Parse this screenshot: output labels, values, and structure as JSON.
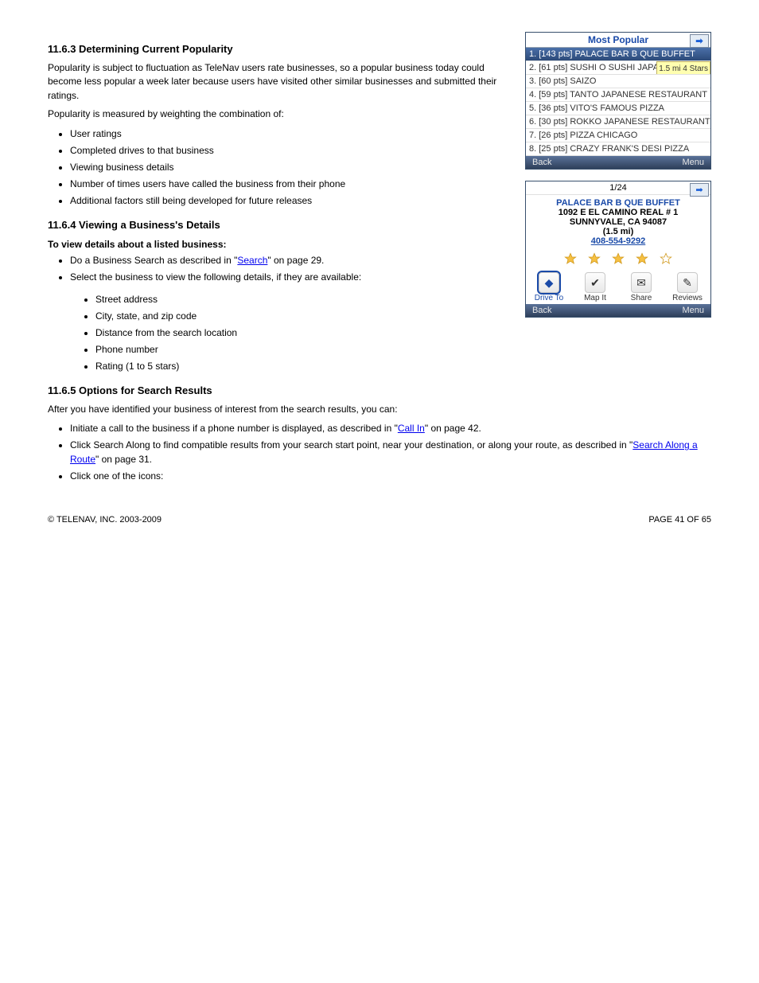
{
  "section1": {
    "title": "11.6.3 Determining Current Popularity",
    "p1": "Popularity is subject to fluctuation as TeleNav users rate businesses, so a popular business today could become less popular a week later because users have visited other similar businesses and submitted their ratings.",
    "p2": "Popularity is measured by weighting the combination of:",
    "bullets": [
      "User ratings",
      "Completed drives to that business",
      "Viewing business details",
      "Number of times users have called the business from their phone",
      "Additional factors still being developed for future releases"
    ]
  },
  "section2": {
    "title": "11.6.4 Viewing a Business's Details",
    "lead_head": "To view details about a listed business:",
    "lead_bullets": [
      {
        "pre": "Do a Business Search as described in \"",
        "link": "Search",
        "post": "\" on page 29."
      },
      {
        "text": "Select the business to view the following details, if they are available:"
      }
    ],
    "detail_bullets": [
      "Street address",
      "City, state, and zip code",
      "Distance from the search location",
      "Phone number",
      "Rating (1 to 5 stars)"
    ]
  },
  "section3": {
    "title": "11.6.5 Options for Search Results",
    "lead": "After you have identified your business of interest from the search results, you can:",
    "bullets": [
      {
        "pre": "Initiate a call to the business if a phone number is displayed, as described in \"",
        "link": "Call In",
        "post": "\" on page 42."
      },
      {
        "pre": "Click Search Along to find compatible results from your search start point, near your destination, or along your route, as described in \"",
        "link": "Search Along a Route",
        "post": "\" on page 31."
      },
      {
        "text": "Click one of the icons:"
      }
    ]
  },
  "popular_mock": {
    "title": "Most Popular",
    "items": [
      {
        "label": "1. [143 pts] PALACE BAR B QUE BUFFET",
        "selected": true
      },
      {
        "label": "2. [61 pts] SUSHI O SUSHI JAPAN",
        "tip": "1.5 mi 4 Stars"
      },
      {
        "label": "3. [60 pts] SAIZO"
      },
      {
        "label": "4. [59 pts] TANTO JAPANESE RESTAURANT"
      },
      {
        "label": "5. [36 pts] VITO'S FAMOUS PIZZA"
      },
      {
        "label": "6. [30 pts] ROKKO JAPANESE RESTAURANT"
      },
      {
        "label": "7. [26 pts] PIZZA CHICAGO"
      },
      {
        "label": "8. [25 pts] CRAZY FRANK'S DESI PIZZA"
      }
    ],
    "back": "Back",
    "menu": "Menu"
  },
  "detail_mock": {
    "counter": "1/24",
    "name": "PALACE BAR B QUE BUFFET",
    "addr1": "1092 E EL CAMINO REAL # 1",
    "addr2": "SUNNYVALE, CA 94087",
    "dist": "(1.5 mi)",
    "phone": "408-554-9292",
    "stars": [
      true,
      true,
      true,
      true,
      false
    ],
    "actions": [
      {
        "label": "Drive To",
        "glyph": "◆",
        "sel": true
      },
      {
        "label": "Map It",
        "glyph": "✔"
      },
      {
        "label": "Share",
        "glyph": "✉"
      },
      {
        "label": "Reviews",
        "glyph": "✎"
      }
    ],
    "back": "Back",
    "menu": "Menu"
  },
  "footer": {
    "left": "© TELENAV, INC. 2003-2009",
    "right": "PAGE 41 OF 65"
  }
}
